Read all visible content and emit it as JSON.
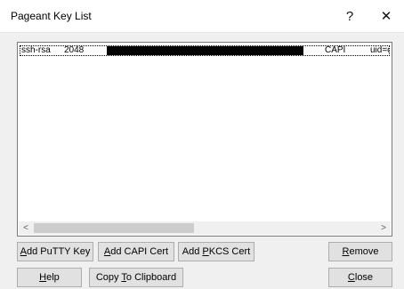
{
  "window": {
    "title": "Pageant Key List",
    "help_glyph": "?",
    "close_glyph": "✕"
  },
  "key_list": {
    "rows": [
      {
        "type": "ssh-rsa",
        "bits": "2048",
        "source": "CAPI",
        "comment": "uid=ci"
      }
    ],
    "scroll_left": "<",
    "scroll_right": ">"
  },
  "buttons": {
    "add_putty_key": {
      "pre": "",
      "key": "A",
      "post": "dd PuTTY Key"
    },
    "add_capi_cert": {
      "pre": "",
      "key": "A",
      "post": "dd CAPI Cert"
    },
    "add_pkcs_cert": {
      "pre": "Add ",
      "key": "P",
      "post": "KCS Cert"
    },
    "remove": {
      "pre": "",
      "key": "R",
      "post": "emove"
    },
    "help": {
      "pre": "",
      "key": "H",
      "post": "elp"
    },
    "copy_clipboard": {
      "pre": "Copy ",
      "key": "T",
      "post": "o Clipboard"
    },
    "close": {
      "pre": "",
      "key": "C",
      "post": "lose"
    }
  }
}
